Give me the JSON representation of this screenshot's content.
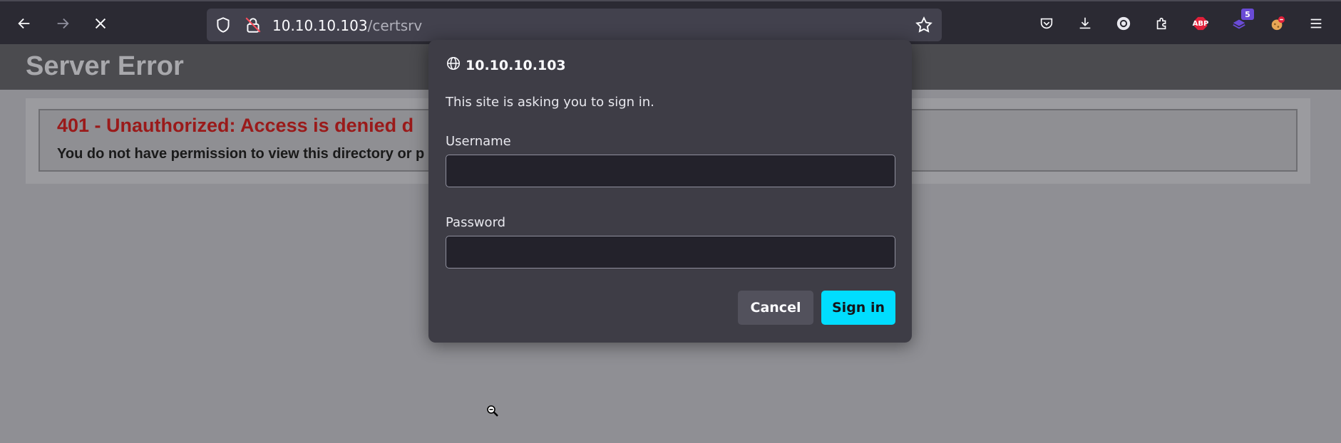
{
  "browser": {
    "url_host": "10.10.10.103",
    "url_path": "/certsrv",
    "icons": [
      "back-arrow-icon",
      "forward-arrow-icon",
      "stop-loading-icon",
      "tracking-shield-icon",
      "insecure-lock-icon",
      "bookmark-star-icon",
      "pocket-icon",
      "download-icon",
      "extension-circle-icon",
      "puzzle-extensions-icon",
      "adblock-plus-icon",
      "stack-extension-icon",
      "cookie-extension-icon",
      "hamburger-menu-icon"
    ],
    "adblock_label": "ABP",
    "extension_badge": "5"
  },
  "page": {
    "title": "Server Error",
    "error_heading": "401 - Unauthorized: Access is denied d",
    "error_message": "You do not have permission to view this directory or p"
  },
  "dialog": {
    "host": "10.10.10.103",
    "message": "This site is asking you to sign in.",
    "username_label": "Username",
    "username_value": "",
    "password_label": "Password",
    "password_value": "",
    "cancel_label": "Cancel",
    "signin_label": "Sign in",
    "accent_color": "#00ddff"
  }
}
